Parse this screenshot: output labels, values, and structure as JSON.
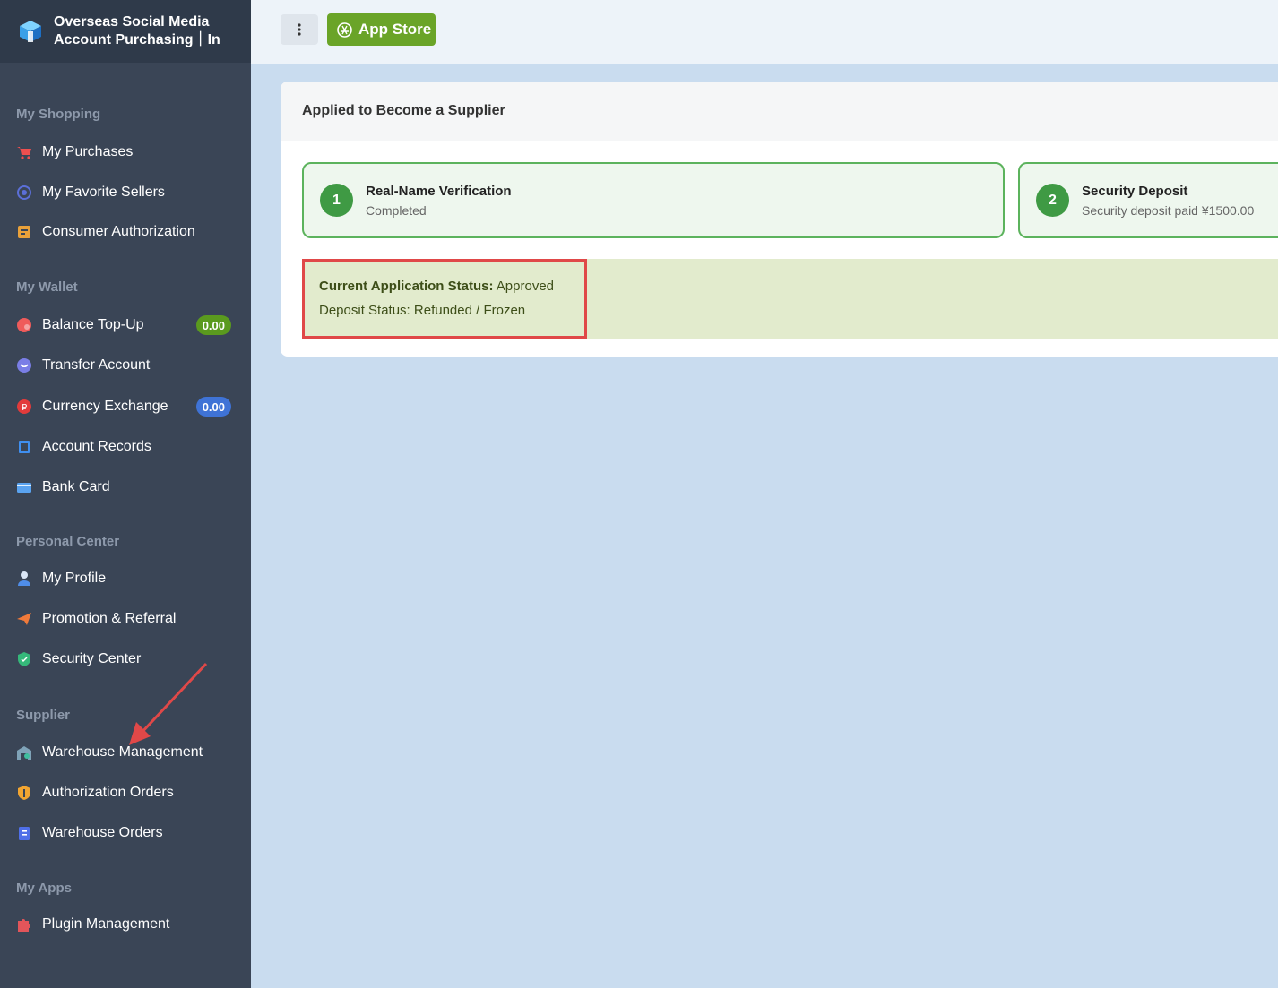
{
  "brand": {
    "title": "Overseas Social Media Account Purchasing｜In"
  },
  "sidebar": {
    "sections": [
      {
        "title": "My Shopping"
      },
      {
        "title": "My Wallet"
      },
      {
        "title": "Personal Center"
      },
      {
        "title": "Supplier"
      },
      {
        "title": "My Apps"
      }
    ],
    "items": [
      {
        "label": "My Purchases",
        "icon": "cart-icon"
      },
      {
        "label": "My Favorite Sellers",
        "icon": "target-icon"
      },
      {
        "label": "Consumer Authorization",
        "icon": "authorization-icon"
      },
      {
        "label": "Balance Top-Up",
        "icon": "topup-icon",
        "badge": "0.00"
      },
      {
        "label": "Transfer Account",
        "icon": "transfer-icon"
      },
      {
        "label": "Currency Exchange",
        "icon": "exchange-icon",
        "badge": "0.00"
      },
      {
        "label": "Account Records",
        "icon": "records-icon"
      },
      {
        "label": "Bank Card",
        "icon": "bank-card-icon"
      },
      {
        "label": "My Profile",
        "icon": "user-icon"
      },
      {
        "label": "Promotion & Referral",
        "icon": "paper-plane-icon"
      },
      {
        "label": "Security Center",
        "icon": "shield-icon"
      },
      {
        "label": "Warehouse Management",
        "icon": "warehouse-icon"
      },
      {
        "label": "Authorization Orders",
        "icon": "badge-icon"
      },
      {
        "label": "Warehouse Orders",
        "icon": "clipboard-icon"
      },
      {
        "label": "Plugin Management",
        "icon": "puzzle-icon"
      }
    ]
  },
  "topbar": {
    "app_store_label": "App Store"
  },
  "panel": {
    "title": "Applied to Become a Supplier",
    "steps": [
      {
        "number": "1",
        "title": "Real-Name Verification",
        "desc": "Completed"
      },
      {
        "number": "2",
        "title": "Security Deposit",
        "desc": "Security deposit paid ¥1500.00"
      }
    ],
    "status": {
      "application_label": "Current Application Status:",
      "application_value": "Approved",
      "deposit_label": "Deposit Status:",
      "deposit_value": "Refunded / Frozen"
    }
  },
  "colors": {
    "sidebar_bg": "#3a4556",
    "accent_green": "#6aa428",
    "step_green": "#3f9a44",
    "highlight_red": "#e04848"
  }
}
